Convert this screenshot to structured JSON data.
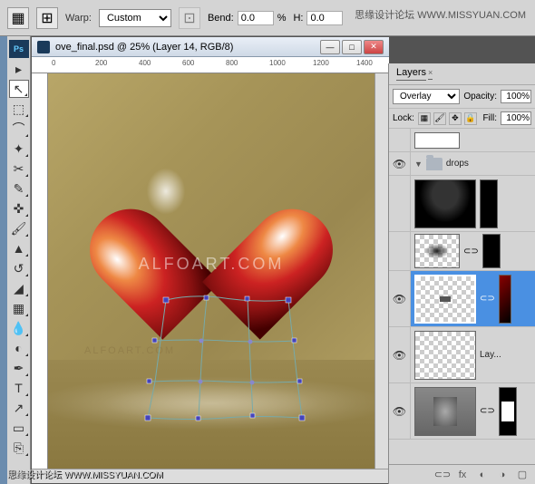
{
  "watermarks": {
    "top_cn": "思缘设计论坛 WWW.MISSYUAN.COM",
    "bottom_cn": "思缘设计论坛 WWW.MISSYUAN.COM",
    "canvas_brand": "ALFOART.COM",
    "canvas_brand2": "ALFOART.COM"
  },
  "options": {
    "warp_label": "Warp:",
    "warp_value": "Custom",
    "bend_label": "Bend:",
    "bend_value": "0.0",
    "percent": "%",
    "h_label": "H:",
    "h_value": "0.0"
  },
  "document": {
    "title": "ove_final.psd @ 25% (Layer 14, RGB/8)",
    "ruler_marks": [
      "0",
      "200",
      "400",
      "600",
      "800",
      "1000",
      "1200",
      "1400"
    ]
  },
  "layers_panel": {
    "tab": "Layers",
    "blend_mode": "Overlay",
    "opacity_label": "Opacity:",
    "opacity_value": "100%",
    "lock_label": "Lock:",
    "fill_label": "Fill:",
    "fill_value": "100%",
    "group_name": "drops",
    "layer_truncated": "Lay..."
  }
}
